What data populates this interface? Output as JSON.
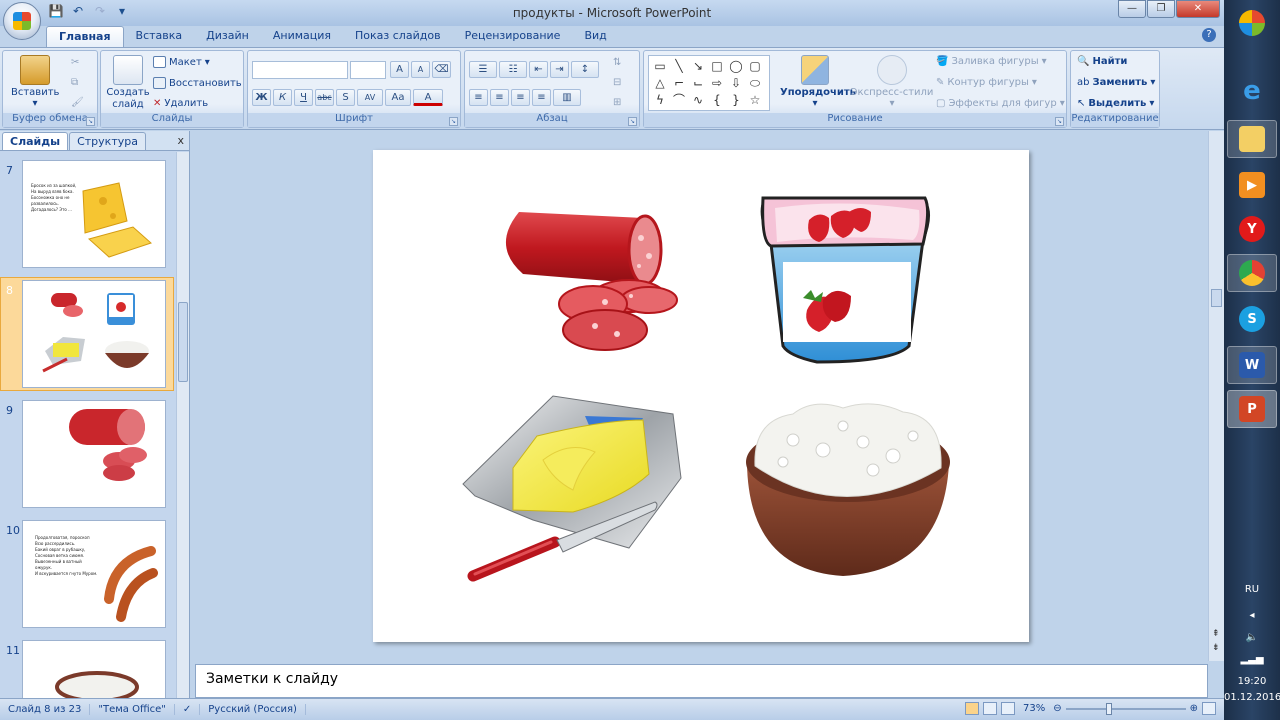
{
  "window": {
    "title": "продукты - Microsoft PowerPoint"
  },
  "tabs": [
    "Главная",
    "Вставка",
    "Дизайн",
    "Анимация",
    "Показ слайдов",
    "Рецензирование",
    "Вид"
  ],
  "ribbon": {
    "clipboard": {
      "label": "Буфер обмена",
      "paste": "Вставить"
    },
    "slides": {
      "label": "Слайды",
      "new_slide": "Создать слайд",
      "layout": "Макет",
      "reset": "Восстановить",
      "delete": "Удалить"
    },
    "font": {
      "label": "Шрифт",
      "bold": "Ж",
      "italic": "К",
      "underline": "Ч",
      "strike": "abc",
      "shadow": "S",
      "spacing": "AV",
      "case": "Aa",
      "grow": "A",
      "shrink": "A",
      "color": "A"
    },
    "paragraph": {
      "label": "Абзац"
    },
    "drawing": {
      "label": "Рисование",
      "arrange": "Упорядочить",
      "quick_styles": "Экспресс-стили",
      "fill": "Заливка фигуры",
      "outline": "Контур фигуры",
      "effects": "Эффекты для фигур"
    },
    "editing": {
      "label": "Редактирование",
      "find": "Найти",
      "replace": "Заменить",
      "select": "Выделить"
    }
  },
  "left_pane": {
    "tab_slides": "Слайды",
    "tab_outline": "Структура",
    "close": "x",
    "thumbs": [
      {
        "num": "7",
        "lines": [
          "Бросок из за шапкой,",
          "На выруд взяв бока.",
          "Босоножка оно не",
          "развалилось.",
          "Догадалось? Это ..."
        ]
      },
      {
        "num": "8",
        "lines": []
      },
      {
        "num": "9",
        "lines": []
      },
      {
        "num": "10",
        "lines": [
          "Продолговатая, пороскоп",
          "Всю рассердились.",
          "Бакий овраг в рубашку,",
          "Сосновая ветка сиюмя.",
          "Вывезенный в ватный",
          "ожурук.",
          "И вскуривается гнуто Муром."
        ]
      },
      {
        "num": "11",
        "lines": []
      }
    ]
  },
  "notes": {
    "placeholder": "Заметки к слайду"
  },
  "status": {
    "slide": "Слайд 8 из 23",
    "theme": "\"Тема Office\"",
    "language": "Русский (Россия)",
    "zoom": "73%"
  },
  "taskbar": {
    "lang": "RU",
    "time": "19:20",
    "date": "01.12.2016"
  }
}
